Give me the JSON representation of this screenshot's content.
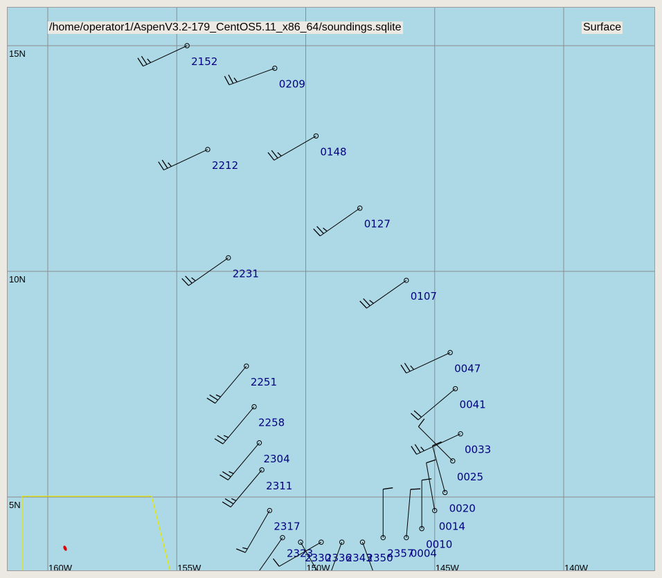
{
  "file_path": "/home/operator1/AspenV3.2-179_CentOS5.11_x86_64/soundings.sqlite",
  "level": "Surface",
  "colors": {
    "ocean": "#add8e6",
    "gridline": "#8c8c8c",
    "barb": "#000000",
    "label": "#000080",
    "boundary": "#e6e600",
    "island": "#dd0000"
  },
  "lat_labels": [
    "15N",
    "10N",
    "5N"
  ],
  "lon_labels": [
    "160W",
    "155W",
    "150W",
    "145W",
    "140W"
  ],
  "soundings": [
    {
      "id": "2152",
      "lon": -154.6,
      "lat": 15.0,
      "dir_deg": 245,
      "speed_kt": 25
    },
    {
      "id": "0209",
      "lon": -151.2,
      "lat": 14.5,
      "dir_deg": 250,
      "speed_kt": 25
    },
    {
      "id": "0148",
      "lon": -149.6,
      "lat": 13.0,
      "dir_deg": 240,
      "speed_kt": 25
    },
    {
      "id": "2212",
      "lon": -153.8,
      "lat": 12.7,
      "dir_deg": 245,
      "speed_kt": 25
    },
    {
      "id": "0127",
      "lon": -147.9,
      "lat": 11.4,
      "dir_deg": 235,
      "speed_kt": 25
    },
    {
      "id": "2231",
      "lon": -153.0,
      "lat": 10.3,
      "dir_deg": 235,
      "speed_kt": 25
    },
    {
      "id": "0107",
      "lon": -146.1,
      "lat": 9.8,
      "dir_deg": 235,
      "speed_kt": 25
    },
    {
      "id": "2251",
      "lon": -152.3,
      "lat": 7.9,
      "dir_deg": 220,
      "speed_kt": 25
    },
    {
      "id": "0047",
      "lon": -144.4,
      "lat": 8.2,
      "dir_deg": 245,
      "speed_kt": 25
    },
    {
      "id": "2258",
      "lon": -152.0,
      "lat": 7.0,
      "dir_deg": 220,
      "speed_kt": 25
    },
    {
      "id": "0041",
      "lon": -144.2,
      "lat": 7.4,
      "dir_deg": 230,
      "speed_kt": 20
    },
    {
      "id": "2304",
      "lon": -151.8,
      "lat": 6.2,
      "dir_deg": 220,
      "speed_kt": 25
    },
    {
      "id": "0033",
      "lon": -144.0,
      "lat": 6.4,
      "dir_deg": 245,
      "speed_kt": 25
    },
    {
      "id": "2311",
      "lon": -151.7,
      "lat": 5.6,
      "dir_deg": 220,
      "speed_kt": 25
    },
    {
      "id": "0025",
      "lon": -144.3,
      "lat": 5.8,
      "dir_deg": 315,
      "speed_kt": 10
    },
    {
      "id": "2317",
      "lon": -151.4,
      "lat": 4.7,
      "dir_deg": 210,
      "speed_kt": 15
    },
    {
      "id": "0020",
      "lon": -144.6,
      "lat": 5.1,
      "dir_deg": 345,
      "speed_kt": 10
    },
    {
      "id": "2323",
      "lon": -150.9,
      "lat": 4.1,
      "dir_deg": 215,
      "speed_kt": 10
    },
    {
      "id": "0014",
      "lon": -145.0,
      "lat": 4.7,
      "dir_deg": 350,
      "speed_kt": 10
    },
    {
      "id": "2330",
      "lon": -150.2,
      "lat": 4.0,
      "dir_deg": 150,
      "speed_kt": 10
    },
    {
      "id": "0010",
      "lon": -145.5,
      "lat": 4.3,
      "dir_deg": 0,
      "speed_kt": 10
    },
    {
      "id": "2336",
      "lon": -149.4,
      "lat": 4.0,
      "dir_deg": 240,
      "speed_kt": 10
    },
    {
      "id": "0004",
      "lon": -146.1,
      "lat": 4.1,
      "dir_deg": 5,
      "speed_kt": 10
    },
    {
      "id": "2343",
      "lon": -148.6,
      "lat": 4.0,
      "dir_deg": 200,
      "speed_kt": 10
    },
    {
      "id": "2350",
      "lon": -147.8,
      "lat": 4.0,
      "dir_deg": 160,
      "speed_kt": 10
    },
    {
      "id": "2357",
      "lon": -147.0,
      "lat": 4.1,
      "dir_deg": 0,
      "speed_kt": 10
    }
  ]
}
